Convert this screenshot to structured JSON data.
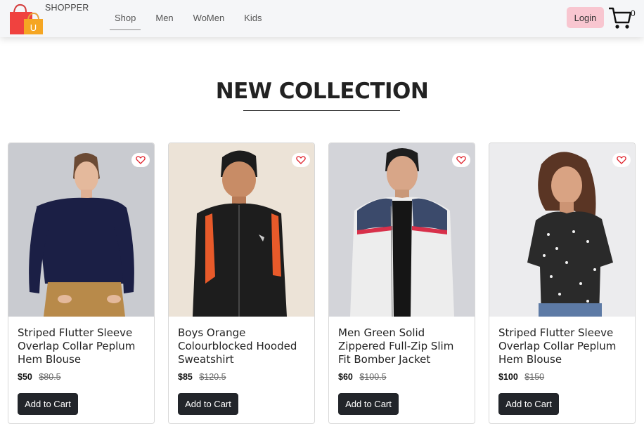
{
  "header": {
    "brand": "SHOPPER",
    "logo_letter": "U",
    "nav": [
      {
        "label": "Shop",
        "active": true
      },
      {
        "label": "Men",
        "active": false
      },
      {
        "label": "WoMen",
        "active": false
      },
      {
        "label": "Kids",
        "active": false
      }
    ],
    "login_label": "Login",
    "cart_count": "0",
    "icons": {
      "logo": "shopping-bag-logo-icon",
      "cart": "cart-icon"
    }
  },
  "section": {
    "title": "NEW COLLECTION"
  },
  "products": [
    {
      "name": "Striped Flutter Sleeve Overlap Collar Peplum Hem Blouse",
      "price": "$50",
      "old_price": "$80.5",
      "add_label": "Add to Cart"
    },
    {
      "name": "Boys Orange Colourblocked Hooded Sweatshirt",
      "price": "$85",
      "old_price": "$120.5",
      "add_label": "Add to Cart"
    },
    {
      "name": "Men Green Solid Zippered Full-Zip Slim Fit Bomber Jacket",
      "price": "$60",
      "old_price": "$100.5",
      "add_label": "Add to Cart"
    },
    {
      "name": "Striped Flutter Sleeve Overlap Collar Peplum Hem Blouse",
      "price": "$100",
      "old_price": "$150",
      "add_label": "Add to Cart"
    }
  ],
  "colors": {
    "login_bg": "#f8c6d0",
    "button_dark": "#22252a",
    "heart": "#e0202a"
  }
}
